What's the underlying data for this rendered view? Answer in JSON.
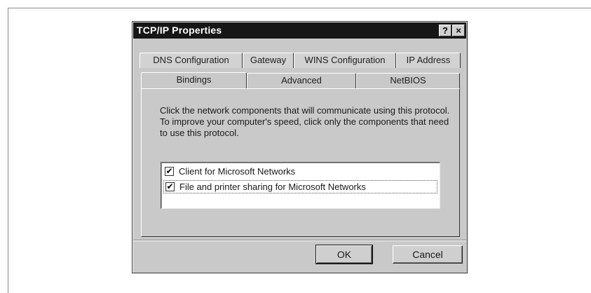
{
  "dialog": {
    "title": "TCP/IP Properties",
    "help_label": "?",
    "close_label": "×"
  },
  "tabs": {
    "back_row": [
      "DNS Configuration",
      "Gateway",
      "WINS Configuration",
      "IP Address"
    ],
    "front_row": [
      "Bindings",
      "Advanced",
      "NetBIOS"
    ],
    "active": "Bindings"
  },
  "bindings": {
    "description": "Click the network components that will communicate using this protocol. To improve your computer's speed, click only the components that need to use this protocol.",
    "items": [
      {
        "label": "Client for Microsoft Networks",
        "checked": true
      },
      {
        "label": "File and printer sharing for Microsoft Networks",
        "checked": true
      }
    ],
    "check_glyph": "✔"
  },
  "buttons": {
    "ok": "OK",
    "cancel": "Cancel"
  }
}
